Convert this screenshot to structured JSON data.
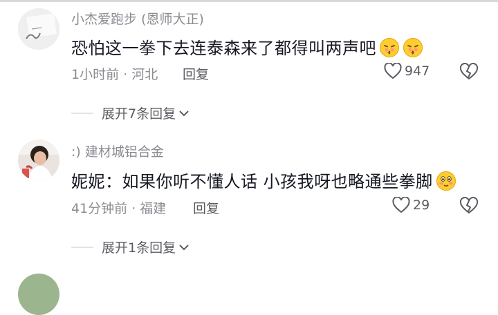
{
  "comments": [
    {
      "username": "小杰爱跑步 (恩师大正)",
      "text": "恐怕这一拳下去连泰森来了都得叫两声吧",
      "emojis": [
        "kiss-emoji",
        "kiss-emoji"
      ],
      "time_location": "1小时前 · 河北",
      "reply_label": "回复",
      "likes": "947",
      "expand_label": "展开7条回复"
    },
    {
      "username": ":) 建材城铝合金",
      "text": "妮妮：如果你听不懂人话 小孩我呀也略通些拳脚",
      "emojis": [
        "blush-emoji"
      ],
      "time_location": "41分钟前 · 福建",
      "reply_label": "回复",
      "likes": "29",
      "expand_label": "展开1条回复"
    }
  ],
  "colors": {
    "primary_text": "#161823",
    "secondary_text": "#8a8b91",
    "action_text": "#5a5b61",
    "emoji_yellow": "#ffcc33",
    "emoji_blush": "#ff8a8a"
  },
  "icons": {
    "like": "heart-outline-icon",
    "dislike": "broken-heart-icon",
    "expand": "chevron-down-icon"
  }
}
